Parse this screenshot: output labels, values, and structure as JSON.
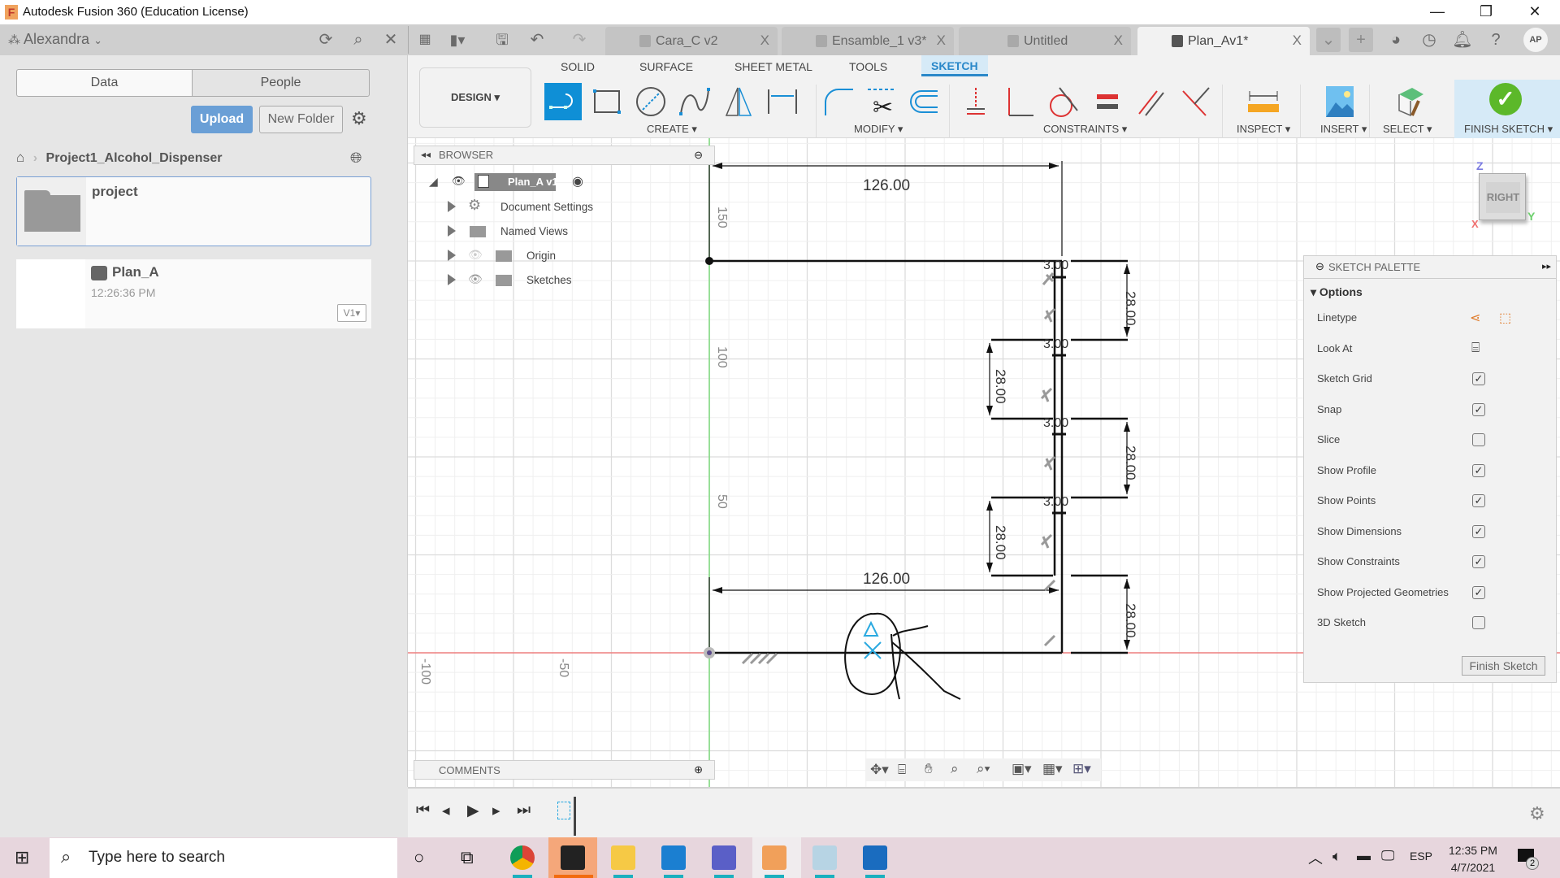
{
  "window": {
    "title": "Autodesk Fusion 360 (Education License)",
    "controls": [
      "—",
      "❐",
      "✕"
    ]
  },
  "header": {
    "user": "Alexandra",
    "tabs": [
      {
        "label": "Cara_C v2",
        "active": false
      },
      {
        "label": "Ensamble_1 v3*",
        "active": false
      },
      {
        "label": "Untitled",
        "active": false
      },
      {
        "label": "Plan_Av1*",
        "active": true
      }
    ],
    "close_glyph": "X",
    "avatar": "AP"
  },
  "datapanel": {
    "tabs": [
      "Data",
      "People"
    ],
    "upload": "Upload",
    "new_folder": "New Folder",
    "breadcrumb": "Project1_Alcohol_Dispenser",
    "folder": {
      "name": "project"
    },
    "file": {
      "name": "Plan_A",
      "time": "12:26:36 PM",
      "version": "V1"
    }
  },
  "ribbon": {
    "workspace": "DESIGN ▾",
    "tabs": [
      "SOLID",
      "SURFACE",
      "SHEET METAL",
      "TOOLS",
      "SKETCH"
    ],
    "active_tab": "SKETCH",
    "groups": {
      "create": "CREATE ▾",
      "modify": "MODIFY ▾",
      "constraints": "CONSTRAINTS ▾",
      "inspect": "INSPECT ▾",
      "insert": "INSERT ▾",
      "select": "SELECT ▾",
      "finish": "FINISH SKETCH ▾"
    }
  },
  "browser": {
    "title": "BROWSER",
    "root": "Plan_A v1",
    "items": [
      "Document Settings",
      "Named Views",
      "Origin",
      "Sketches"
    ]
  },
  "comments": {
    "title": "COMMENTS"
  },
  "viewcube": {
    "face": "RIGHT",
    "axes": {
      "z": "Z",
      "y": "Y",
      "x": "X"
    }
  },
  "sketch": {
    "dimensions": {
      "top_width": "126.00",
      "bottom_width": "126.00",
      "slot_height": "28.00",
      "gap": "3.00"
    },
    "axis_labels": {
      "v150": "150",
      "v100": "100",
      "v50": "50",
      "h_neg50": "-50",
      "h_neg100": "-100"
    }
  },
  "palette": {
    "title": "SKETCH PALETTE",
    "section": "Options",
    "options": [
      {
        "label": "Linetype",
        "type": "icons"
      },
      {
        "label": "Look At",
        "type": "icon"
      },
      {
        "label": "Sketch Grid",
        "checked": true
      },
      {
        "label": "Snap",
        "checked": true
      },
      {
        "label": "Slice",
        "checked": false
      },
      {
        "label": "Show Profile",
        "checked": true
      },
      {
        "label": "Show Points",
        "checked": true
      },
      {
        "label": "Show Dimensions",
        "checked": true
      },
      {
        "label": "Show Constraints",
        "checked": true
      },
      {
        "label": "Show Projected Geometries",
        "checked": true
      },
      {
        "label": "3D Sketch",
        "checked": false
      }
    ],
    "finish": "Finish Sketch"
  },
  "taskbar": {
    "search_placeholder": "Type here to search",
    "language": "ESP",
    "time": "12:35 PM",
    "date": "4/7/2021",
    "notifications": "2"
  },
  "colors": {
    "accent": "#2a88c9",
    "finish_green": "#5cb82a",
    "x_axis": "#f08080",
    "y_axis": "#7ad87a"
  }
}
